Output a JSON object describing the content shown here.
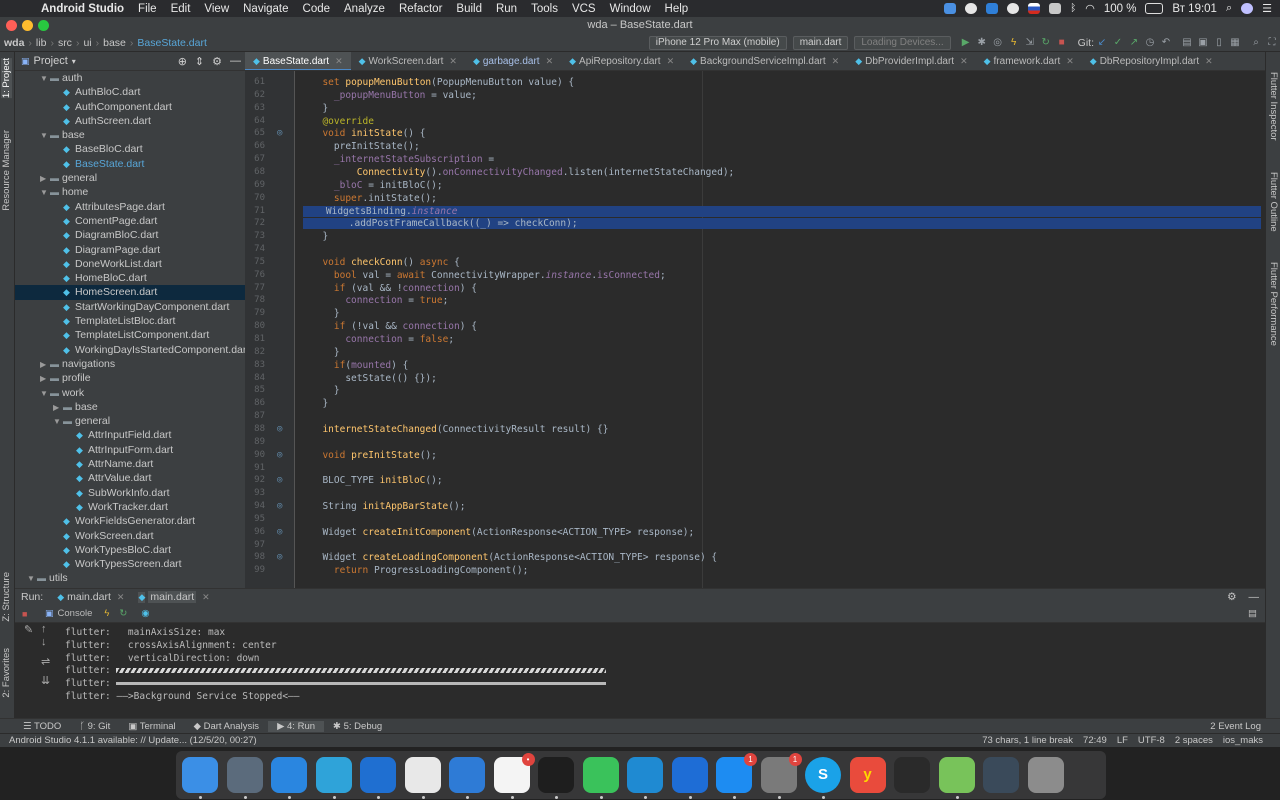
{
  "menubar": {
    "app": "Android Studio",
    "items": [
      "File",
      "Edit",
      "View",
      "Navigate",
      "Code",
      "Analyze",
      "Refactor",
      "Build",
      "Run",
      "Tools",
      "VCS",
      "Window",
      "Help"
    ],
    "battery": "100 %",
    "clock": "Вт 19:01"
  },
  "window": {
    "title": "wda – BaseState.dart"
  },
  "navbar": {
    "crumbs": [
      "wda",
      "lib",
      "src",
      "ui",
      "base",
      "BaseState.dart"
    ],
    "device": "iPhone 12 Pro Max (mobile)",
    "config": "main.dart",
    "loading": "Loading Devices...",
    "git_label": "Git:"
  },
  "leftstrip": {
    "project": "1: Project",
    "resource": "Resource Manager",
    "structure": "Z: Structure",
    "favorites": "2: Favorites"
  },
  "rightstrip": {
    "inspector": "Flutter Inspector",
    "outline": "Flutter Outline",
    "performance": "Flutter Performance"
  },
  "project": {
    "title": "Project",
    "tree": [
      {
        "label": "auth",
        "type": "folder",
        "depth": 1,
        "open": true
      },
      {
        "label": "AuthBloC.dart",
        "type": "file",
        "depth": 2
      },
      {
        "label": "AuthComponent.dart",
        "type": "file",
        "depth": 2
      },
      {
        "label": "AuthScreen.dart",
        "type": "file",
        "depth": 2
      },
      {
        "label": "base",
        "type": "folder",
        "depth": 1,
        "open": true
      },
      {
        "label": "BaseBloC.dart",
        "type": "file",
        "depth": 2
      },
      {
        "label": "BaseState.dart",
        "type": "file",
        "depth": 2,
        "active": true
      },
      {
        "label": "general",
        "type": "folder",
        "depth": 1,
        "open": false
      },
      {
        "label": "home",
        "type": "folder",
        "depth": 1,
        "open": true
      },
      {
        "label": "AttributesPage.dart",
        "type": "file",
        "depth": 2
      },
      {
        "label": "ComentPage.dart",
        "type": "file",
        "depth": 2
      },
      {
        "label": "DiagramBloC.dart",
        "type": "file",
        "depth": 2
      },
      {
        "label": "DiagramPage.dart",
        "type": "file",
        "depth": 2
      },
      {
        "label": "DoneWorkList.dart",
        "type": "file",
        "depth": 2
      },
      {
        "label": "HomeBloC.dart",
        "type": "file",
        "depth": 2
      },
      {
        "label": "HomeScreen.dart",
        "type": "file",
        "depth": 2,
        "selected": true
      },
      {
        "label": "StartWorkingDayComponent.dart",
        "type": "file",
        "depth": 2
      },
      {
        "label": "TemplateListBloc.dart",
        "type": "file",
        "depth": 2
      },
      {
        "label": "TemplateListComponent.dart",
        "type": "file",
        "depth": 2
      },
      {
        "label": "WorkingDayIsStartedComponent.dar",
        "type": "file",
        "depth": 2
      },
      {
        "label": "navigations",
        "type": "folder",
        "depth": 1,
        "open": false
      },
      {
        "label": "profile",
        "type": "folder",
        "depth": 1,
        "open": false
      },
      {
        "label": "work",
        "type": "folder",
        "depth": 1,
        "open": true
      },
      {
        "label": "base",
        "type": "folder",
        "depth": 2,
        "open": false
      },
      {
        "label": "general",
        "type": "folder",
        "depth": 2,
        "open": true
      },
      {
        "label": "AttrInputField.dart",
        "type": "file",
        "depth": 3
      },
      {
        "label": "AttrInputForm.dart",
        "type": "file",
        "depth": 3
      },
      {
        "label": "AttrName.dart",
        "type": "file",
        "depth": 3
      },
      {
        "label": "AttrValue.dart",
        "type": "file",
        "depth": 3
      },
      {
        "label": "SubWorkInfo.dart",
        "type": "file",
        "depth": 3
      },
      {
        "label": "WorkTracker.dart",
        "type": "file",
        "depth": 3
      },
      {
        "label": "WorkFieldsGenerator.dart",
        "type": "file",
        "depth": 2
      },
      {
        "label": "WorkScreen.dart",
        "type": "file",
        "depth": 2
      },
      {
        "label": "WorkTypesBloC.dart",
        "type": "file",
        "depth": 2
      },
      {
        "label": "WorkTypesScreen.dart",
        "type": "file",
        "depth": 2
      },
      {
        "label": "utils",
        "type": "folder",
        "depth": 0,
        "open": true
      }
    ]
  },
  "tabs": [
    "BaseState.dart",
    "WorkScreen.dart",
    "garbage.dart",
    "ApiRepository.dart",
    "BackgroundServiceImpl.dart",
    "DbProviderImpl.dart",
    "framework.dart",
    "DbRepositoryImpl.dart"
  ],
  "code": [
    {
      "n": "61",
      "html": "  <span class=\"kw\">set</span> <span class=\"fn\">popupMenuButton</span>(PopupMenuButton value) {"
    },
    {
      "n": "62",
      "html": "    <span class=\"fld\">_popupMenuButton</span> = value;"
    },
    {
      "n": "63",
      "html": "  }"
    },
    {
      "n": "64",
      "html": "  <span class=\"an\">@override</span>"
    },
    {
      "n": "65",
      "html": "  <span class=\"kw\">void</span> <span class=\"fn\">initState</span>() {",
      "mark": "o"
    },
    {
      "n": "66",
      "html": "    preInitState();"
    },
    {
      "n": "67",
      "html": "    <span class=\"fld\">_internetStateSubscription</span> ="
    },
    {
      "n": "68",
      "html": "        <span class=\"fn\">Connectivity</span>().<span class=\"fld\">onConnectivityChanged</span>.listen(internetStateChanged);"
    },
    {
      "n": "69",
      "html": "    <span class=\"fld\">_bloC</span> = initBloC();"
    },
    {
      "n": "70",
      "html": "    <span class=\"kw\">super</span>.initState();"
    },
    {
      "n": "71",
      "html": "    WidgetsBinding.<span class=\"it\">instance</span>",
      "hl": true
    },
    {
      "n": "72",
      "html": "        .addPostFrameCallback((_) =&gt; checkConn);",
      "hl": true
    },
    {
      "n": "73",
      "html": "  }"
    },
    {
      "n": "74",
      "html": ""
    },
    {
      "n": "75",
      "html": "  <span class=\"kw\">void</span> <span class=\"fn\">checkConn</span>() <span class=\"kw\">async</span> {"
    },
    {
      "n": "76",
      "html": "    <span class=\"kw\">bool</span> val = <span class=\"kw\">await</span> ConnectivityWrapper.<span class=\"it\">instance</span>.<span class=\"fld\">isConnected</span>;"
    },
    {
      "n": "77",
      "html": "    <span class=\"kw\">if</span> (val &amp;&amp; !<span class=\"fld\">connection</span>) {"
    },
    {
      "n": "78",
      "html": "      <span class=\"fld\">connection</span> = <span class=\"kw\">true</span>;"
    },
    {
      "n": "79",
      "html": "    }"
    },
    {
      "n": "80",
      "html": "    <span class=\"kw\">if</span> (!val &amp;&amp; <span class=\"fld\">connection</span>) {"
    },
    {
      "n": "81",
      "html": "      <span class=\"fld\">connection</span> = <span class=\"kw\">false</span>;"
    },
    {
      "n": "82",
      "html": "    }"
    },
    {
      "n": "83",
      "html": "    <span class=\"kw\">if</span>(<span class=\"fld\">mounted</span>) {"
    },
    {
      "n": "84",
      "html": "      setState(() {});"
    },
    {
      "n": "85",
      "html": "    }"
    },
    {
      "n": "86",
      "html": "  }"
    },
    {
      "n": "87",
      "html": ""
    },
    {
      "n": "88",
      "html": "  <span class=\"fn\">internetStateChanged</span>(ConnectivityResult result) {}",
      "mark": "o"
    },
    {
      "n": "89",
      "html": ""
    },
    {
      "n": "90",
      "html": "  <span class=\"kw\">void</span> <span class=\"fn\">preInitState</span>();",
      "mark": "o"
    },
    {
      "n": "91",
      "html": ""
    },
    {
      "n": "92",
      "html": "  BLOC_TYPE <span class=\"fn\">initBloC</span>();",
      "mark": "o"
    },
    {
      "n": "93",
      "html": ""
    },
    {
      "n": "94",
      "html": "  String <span class=\"fn\">initAppBarState</span>();",
      "mark": "o"
    },
    {
      "n": "95",
      "html": ""
    },
    {
      "n": "96",
      "html": "  Widget <span class=\"fn\">createInitComponent</span>(ActionResponse&lt;ACTION_TYPE&gt; response);",
      "mark": "o"
    },
    {
      "n": "97",
      "html": ""
    },
    {
      "n": "98",
      "html": "  Widget <span class=\"fn\">createLoadingComponent</span>(ActionResponse&lt;ACTION_TYPE&gt; response) {",
      "mark": "o"
    },
    {
      "n": "99",
      "html": "    <span class=\"kw\">return</span> ProgressLoadingComponent();"
    }
  ],
  "run": {
    "label": "Run:",
    "tabs": [
      "main.dart",
      "main.dart"
    ],
    "console_tab": "Console",
    "lines": [
      "flutter:   mainAxisSize: max",
      "flutter:   crossAxisAlignment: center",
      "flutter:   verticalDirection: down"
    ],
    "bar_prefix": "flutter: ",
    "last_line": "flutter: ——>Background Service Stopped<——"
  },
  "bottom_tools": [
    "TODO",
    "9: Git",
    "Terminal",
    "Dart Analysis",
    "4: Run",
    "5: Debug"
  ],
  "event_log": "2 Event Log",
  "status": {
    "message": "Android Studio 4.1.1 available: // Update... (12/5/20, 00:27)",
    "selection": "73 chars, 1 line break",
    "position": "72:49",
    "line_sep": "LF",
    "encoding": "UTF-8",
    "indent": "2 spaces",
    "branch": "ios_maks"
  },
  "dock": {
    "apps": [
      {
        "icon": "finder-icon",
        "color": "#3b8fe6"
      },
      {
        "icon": "launchpad-icon",
        "color": "#5b6b7c"
      },
      {
        "icon": "safari-icon",
        "color": "#2a86e0"
      },
      {
        "icon": "telegram-icon",
        "color": "#2fa3d9"
      },
      {
        "icon": "xcode-icon",
        "color": "#1f6fd1"
      },
      {
        "icon": "android-studio-icon",
        "color": "#e8e8e8"
      },
      {
        "icon": "instruments-icon",
        "color": "#2e7bd6"
      },
      {
        "icon": "slack-icon",
        "color": "#f4f4f4",
        "badge": "•"
      },
      {
        "icon": "terminal-icon",
        "color": "#1e1e1e"
      },
      {
        "icon": "facetime-icon",
        "color": "#3ac25b"
      },
      {
        "icon": "vscode-icon",
        "color": "#1f8ad2"
      },
      {
        "icon": "teamviewer-icon",
        "color": "#1e6dd6"
      },
      {
        "icon": "app-store-icon",
        "color": "#1d8cf2",
        "badge": "1"
      },
      {
        "icon": "system-preferences-icon",
        "color": "#7a7a7a",
        "badge": "1"
      },
      {
        "icon": "skype-icon",
        "color": "#1aa2e8"
      },
      {
        "icon": "yandex-icon",
        "color": "#e94b3c"
      },
      {
        "icon": "activity-monitor-icon",
        "color": "#2a2a2a"
      },
      {
        "icon": "maps-icon",
        "color": "#78c35a"
      },
      {
        "icon": "screen-icon",
        "color": "#3a4a5a"
      },
      {
        "icon": "trash-icon",
        "color": "#8c8c8c"
      }
    ],
    "skype_letter": "S",
    "yandex_letter": "y"
  }
}
